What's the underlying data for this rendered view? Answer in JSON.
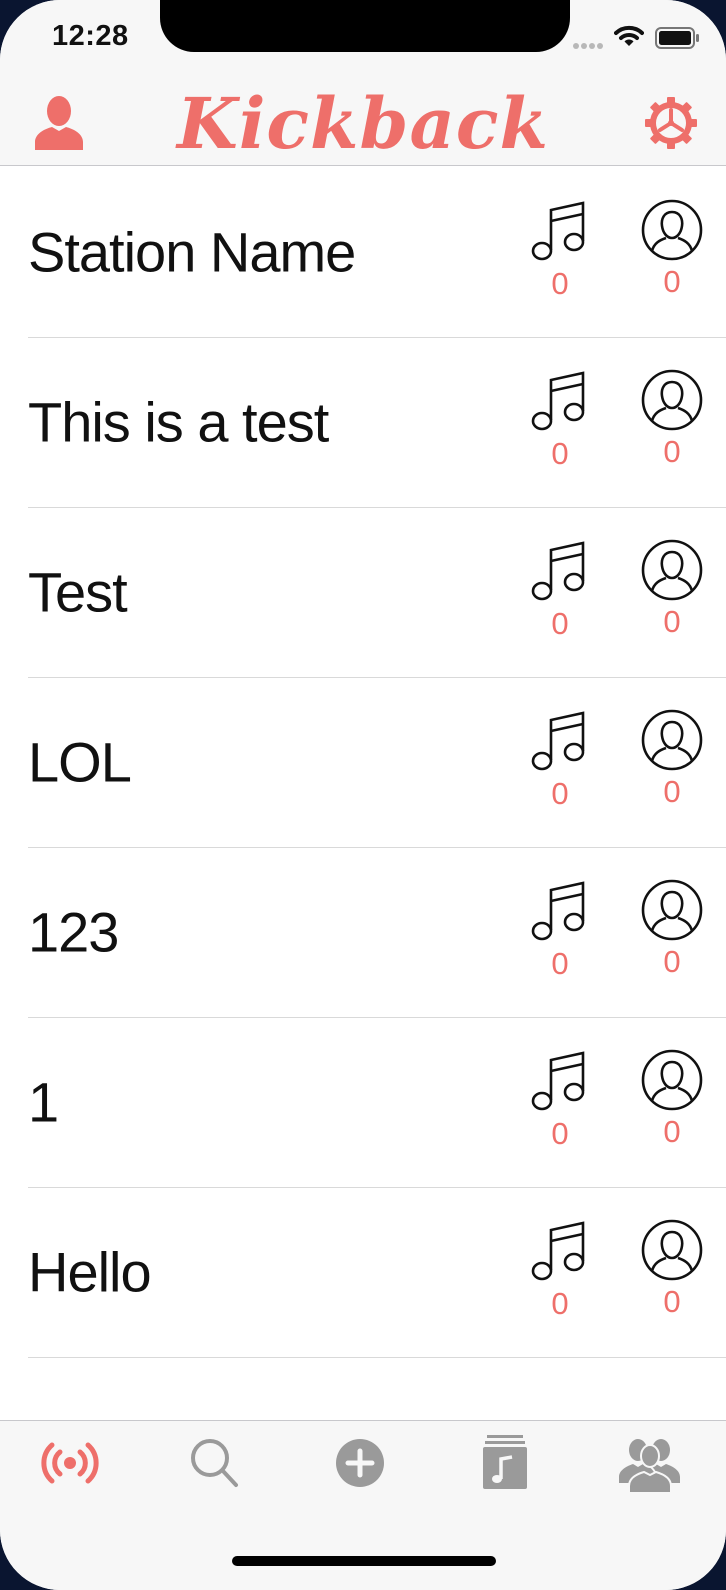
{
  "status_bar": {
    "time": "12:28",
    "icons": [
      "cellular-signal-icon",
      "wifi-icon",
      "battery-icon"
    ]
  },
  "nav": {
    "title": "Kickback",
    "left_icon": "person-icon",
    "right_icon": "gear-icon"
  },
  "colors": {
    "accent": "#ee6f6a",
    "tab_inactive": "#9a9a9a",
    "text": "#111111"
  },
  "stations": [
    {
      "name": "Station Name",
      "songs": "0",
      "listeners": "0"
    },
    {
      "name": "This is a test",
      "songs": "0",
      "listeners": "0"
    },
    {
      "name": "Test",
      "songs": "0",
      "listeners": "0"
    },
    {
      "name": "LOL",
      "songs": "0",
      "listeners": "0"
    },
    {
      "name": "123",
      "songs": "0",
      "listeners": "0"
    },
    {
      "name": "1",
      "songs": "0",
      "listeners": "0"
    },
    {
      "name": "Hello",
      "songs": "0",
      "listeners": "0"
    }
  ],
  "tab_bar": {
    "selected": 0,
    "tabs": [
      {
        "icon": "broadcast-icon"
      },
      {
        "icon": "search-icon"
      },
      {
        "icon": "add-circle-icon"
      },
      {
        "icon": "music-library-icon"
      },
      {
        "icon": "people-icon"
      }
    ]
  }
}
